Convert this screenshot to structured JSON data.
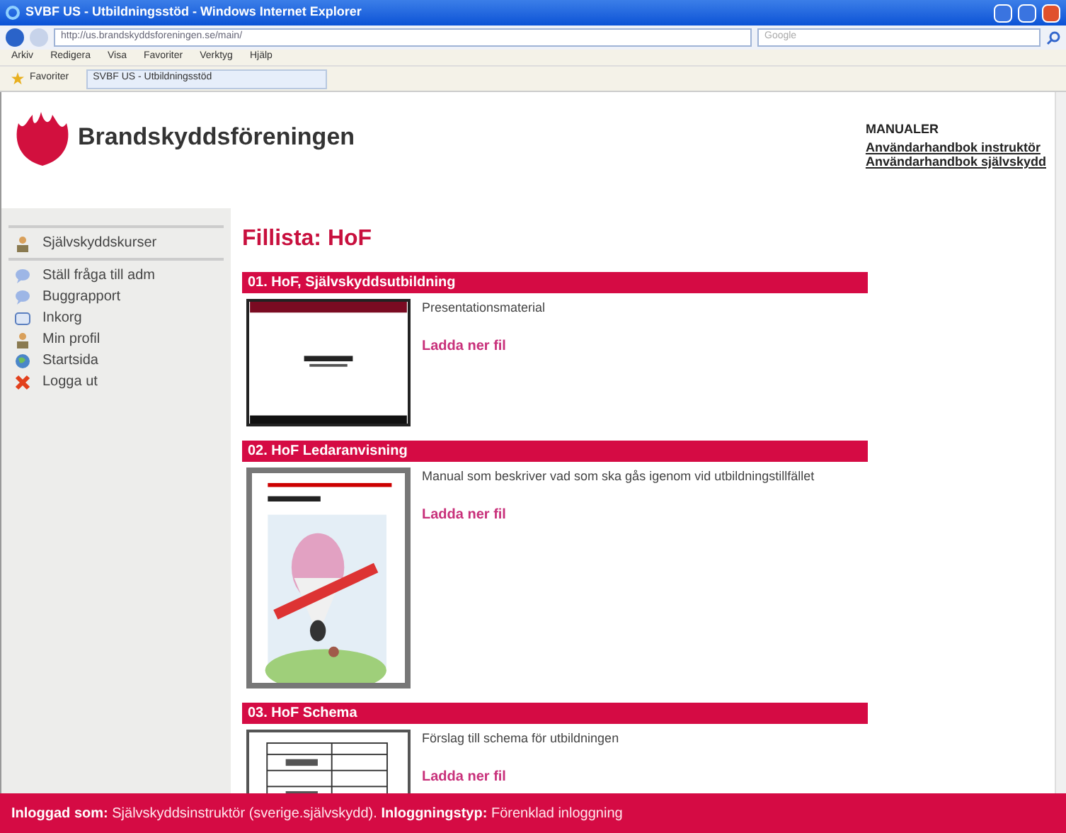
{
  "window": {
    "title": "SVBF US - Utbildningsstöd - Windows Internet Explorer"
  },
  "address_bar": {
    "url": "http://us.brandskyddsforeningen.se/main/"
  },
  "search": {
    "placeholder": "Google"
  },
  "menu": [
    "Arkiv",
    "Redigera",
    "Visa",
    "Favoriter",
    "Verktyg",
    "Hjälp"
  ],
  "favorites_bar": {
    "label": "Favoriter",
    "tab": "SVBF US - Utbildningsstöd"
  },
  "logo": {
    "text": "Brandskyddsföreningen"
  },
  "manuals": {
    "heading": "MANUALER",
    "links": [
      "Användarhandbok instruktör",
      "Användarhandbok självskydd"
    ]
  },
  "sidebar": {
    "items": [
      {
        "label": "Självskyddskurser",
        "kind": "person"
      },
      {
        "label": "Ställ fråga till adm",
        "kind": "bubble"
      },
      {
        "label": "Buggrapport",
        "kind": "bubble"
      },
      {
        "label": "Inkorg",
        "kind": "inbox"
      },
      {
        "label": "Min profil",
        "kind": "person"
      },
      {
        "label": "Startsida",
        "kind": "globe"
      },
      {
        "label": "Logga ut",
        "kind": "cross"
      }
    ]
  },
  "page_title": "Fillista: HoF",
  "files": [
    {
      "title": "01. HoF, Självskyddsutbildning",
      "description": "Presentationsmaterial",
      "link": "Ladda ner fil",
      "kind": "slide"
    },
    {
      "title": "02. HoF Ledaranvisning",
      "description": "Manual som beskriver vad som ska gås igenom vid utbildningstillfället",
      "link": "Ladda ner fil",
      "kind": "cover"
    },
    {
      "title": "03. HoF Schema",
      "description": "Förslag till schema för utbildningen",
      "link": "Ladda ner fil",
      "kind": "table"
    }
  ],
  "footer": {
    "logged_in_label": "Inloggad som:",
    "logged_in_value": "Självskyddsinstruktör (sverige.självskydd).",
    "login_type_label": "Inloggningstyp:",
    "login_type_value": "Förenklad inloggning"
  }
}
